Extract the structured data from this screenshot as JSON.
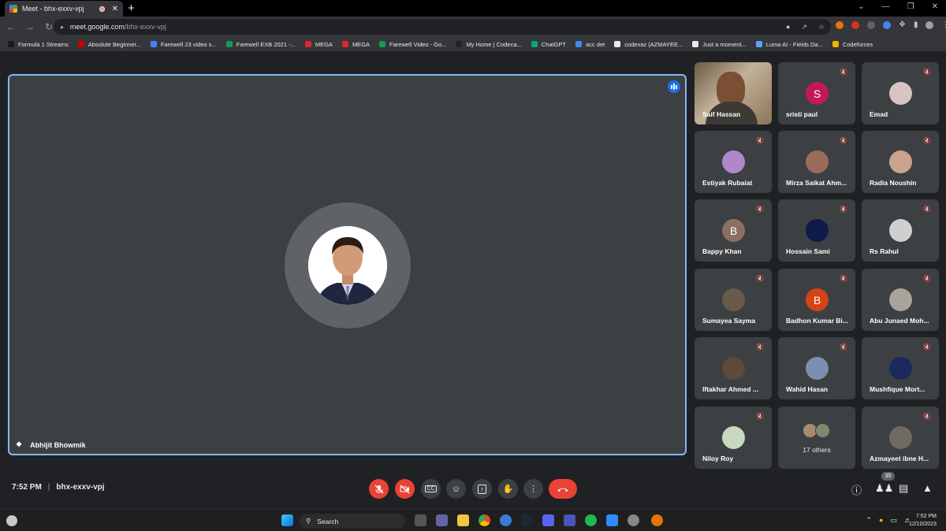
{
  "browser": {
    "tab_title": "Meet - bhx-exxv-vpj",
    "tab_close": "✕",
    "new_tab": "+",
    "window_controls": [
      "⌄",
      "—",
      "❐",
      "✕"
    ],
    "url_host": "meet.google.com",
    "url_path": "/bhx-exxv-vpj"
  },
  "bookmarks": [
    {
      "label": "Formula 1 Streams",
      "color": "#1a1a1a"
    },
    {
      "label": "Absolute Beginner...",
      "color": "#c00"
    },
    {
      "label": "Farewell 23 video s...",
      "color": "#4285f4"
    },
    {
      "label": "Farewell EXB 2021 -...",
      "color": "#0f9d58"
    },
    {
      "label": "MEGA",
      "color": "#d9272e"
    },
    {
      "label": "MEGA",
      "color": "#d9272e"
    },
    {
      "label": "Farewell Video - Go...",
      "color": "#0f9d58"
    },
    {
      "label": "My Home | Codeca...",
      "color": "#222"
    },
    {
      "label": "ChatGPT",
      "color": "#10a37f"
    },
    {
      "label": "acc det",
      "color": "#4285f4"
    },
    {
      "label": "codexaz (AZMAYEE...",
      "color": "#e8eaed"
    },
    {
      "label": "Just a moment...",
      "color": "#e8eaed"
    },
    {
      "label": "Luma AI - Fields Da...",
      "color": "#5ea0ff"
    },
    {
      "label": "Codeforces",
      "color": "#f4b400"
    }
  ],
  "stage": {
    "presenter_name": "Abhijit Bhowmik"
  },
  "participants": [
    {
      "name": "Saif Hassan",
      "type": "video"
    },
    {
      "name": "sristi paul",
      "type": "letter",
      "letter": "S",
      "color": "#c2185b"
    },
    {
      "name": "Emad",
      "type": "photo",
      "color": "#d7c4c0"
    },
    {
      "name": "Estiyak Rubaiat",
      "type": "photo",
      "color": "#b088c9"
    },
    {
      "name": "Mirza Saikat Ahm...",
      "type": "photo",
      "color": "#9a6b5a"
    },
    {
      "name": "Radia Noushin",
      "type": "photo",
      "color": "#c9a48a"
    },
    {
      "name": "Bappy Khan",
      "type": "letter",
      "letter": "B",
      "color": "#8d6e63"
    },
    {
      "name": "Hossain Sami",
      "type": "photo",
      "color": "#0d1b4a"
    },
    {
      "name": "Rs Rahul",
      "type": "photo",
      "color": "#cfcfcf"
    },
    {
      "name": "Sumayea Sayma",
      "type": "photo",
      "color": "#6a5a4a"
    },
    {
      "name": "Badhon Kumar Bi...",
      "type": "letter",
      "letter": "B",
      "color": "#d84315"
    },
    {
      "name": "Abu Junaed Moh...",
      "type": "photo",
      "color": "#a9a39a"
    },
    {
      "name": "Iftakhar Ahmed ...",
      "type": "photo",
      "color": "#5d4a3a"
    },
    {
      "name": "Wahid Hasan",
      "type": "photo",
      "color": "#7b8fb0"
    },
    {
      "name": "Mushfique Mort...",
      "type": "photo",
      "color": "#1b2a5a"
    },
    {
      "name": "Niloy Roy",
      "type": "photo",
      "color": "#c8d8c0"
    },
    {
      "name": "17 others",
      "type": "others"
    },
    {
      "name": "Azmayeet ibne H...",
      "type": "photo",
      "color": "#706a60"
    }
  ],
  "bottom": {
    "time": "7:52 PM",
    "separator": "|",
    "meeting_code": "bhx-exxv-vpj",
    "participant_count": "35"
  },
  "taskbar": {
    "search_label": "Search",
    "clock_time": "7:52 PM",
    "clock_date": "12/10/2023"
  }
}
